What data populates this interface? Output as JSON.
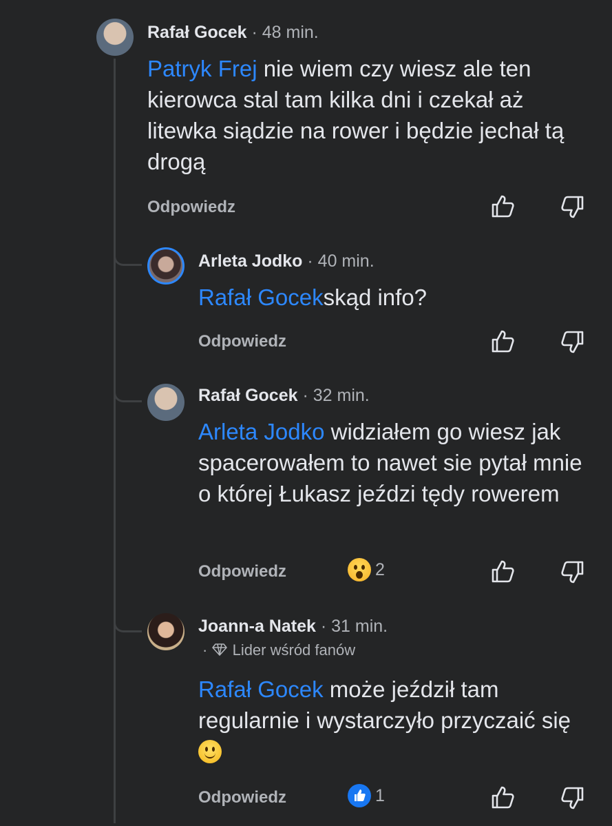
{
  "comments": [
    {
      "author": "Rafał Gocek",
      "time": "48 min.",
      "mention": "Patryk Frej",
      "text": " nie wiem czy wiesz ale ten kierowca stal tam kilka dni i czekał aż litewka siądzie na rower i będzie jechał tą drogą",
      "reply_label": "Odpowiedz"
    },
    {
      "author": "Arleta Jodko",
      "time": "40 min.",
      "mention": "Rafał Gocek",
      "text": "skąd info?",
      "reply_label": "Odpowiedz"
    },
    {
      "author": "Rafał Gocek",
      "time": "32 min.",
      "mention": "Arleta Jodko",
      "text": " widziałem go wiesz jak spacerowałem to nawet sie pytał mnie o której Łukasz jeździ tędy rowerem",
      "reply_label": "Odpowiedz",
      "reaction": {
        "icon": "wow-emoji",
        "count": "2"
      }
    },
    {
      "author": "Joann-a Natek",
      "time": "31 min.",
      "badge": "Lider wśród fanów",
      "mention": "Rafał Gocek",
      "text": " może jeździł tam regularnie i wystarczyło przyczaić się",
      "emoji": "slightly-smiling-face",
      "reply_label": "Odpowiedz",
      "reaction": {
        "icon": "like-reaction",
        "count": "1"
      }
    }
  ],
  "separator": "·",
  "colors": {
    "background": "#242526",
    "mention": "#2d88ff",
    "meta": "#b0b3b8",
    "text": "#e4e6eb"
  }
}
